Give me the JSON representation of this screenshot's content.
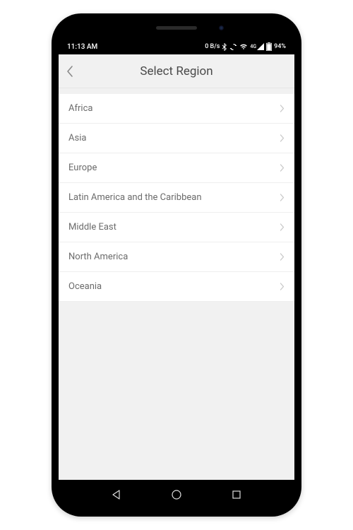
{
  "status": {
    "time": "11:13 AM",
    "speed": "0 B/s",
    "battery": "94%"
  },
  "header": {
    "title": "Select Region"
  },
  "regions": [
    {
      "label": "Africa"
    },
    {
      "label": "Asia"
    },
    {
      "label": "Europe"
    },
    {
      "label": "Latin America and the Caribbean"
    },
    {
      "label": "Middle East"
    },
    {
      "label": "North America"
    },
    {
      "label": "Oceania"
    }
  ]
}
